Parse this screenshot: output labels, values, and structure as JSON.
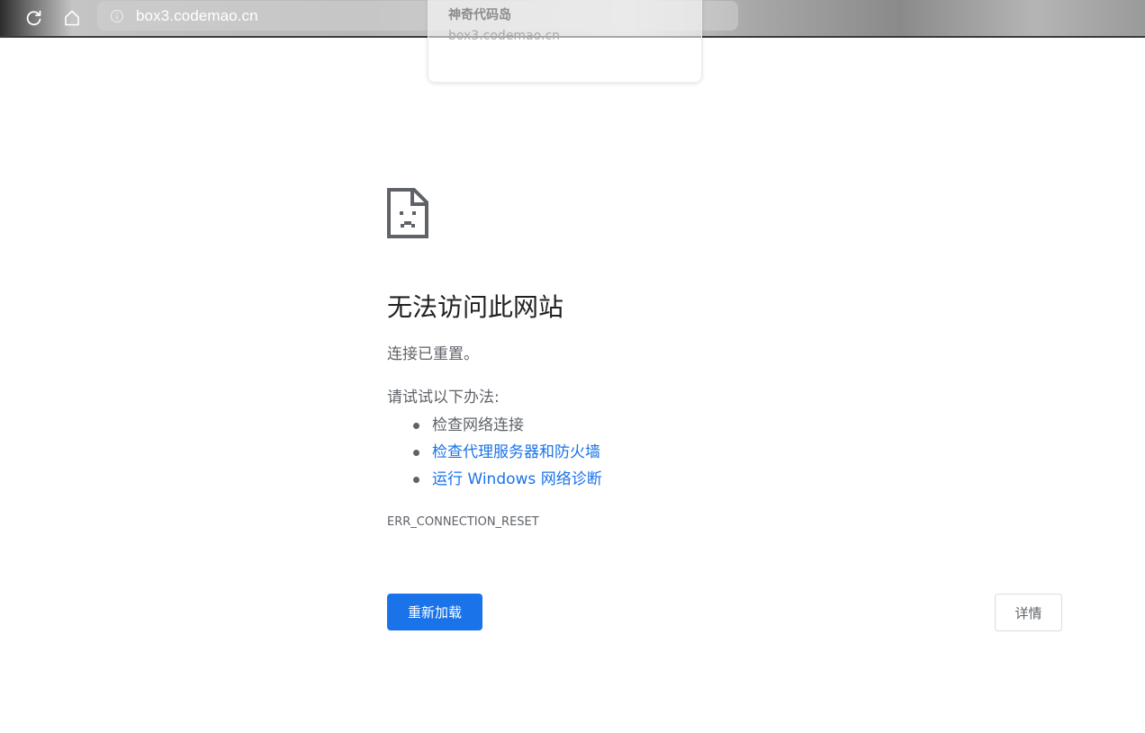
{
  "browser": {
    "url": "box3.codemao.cn",
    "reload_icon": "reload-icon",
    "home_icon": "home-icon",
    "info_icon": "info-icon"
  },
  "popup": {
    "title": "神奇代码岛",
    "url": "box3.codemao.cn"
  },
  "error_page": {
    "icon": "sad-page-icon",
    "heading": "无法访问此网站",
    "subtitle": "连接已重置。",
    "try_label": "请试试以下办法:",
    "suggestions": [
      {
        "text": "检查网络连接",
        "link": false
      },
      {
        "text": "检查代理服务器和防火墙",
        "link": true
      },
      {
        "text": "运行 Windows 网络诊断",
        "link": true
      }
    ],
    "error_code": "ERR_CONNECTION_RESET",
    "reload_label": "重新加载",
    "details_label": "详情",
    "accent_color": "#1a73e8",
    "text_color": "#5f6368"
  }
}
